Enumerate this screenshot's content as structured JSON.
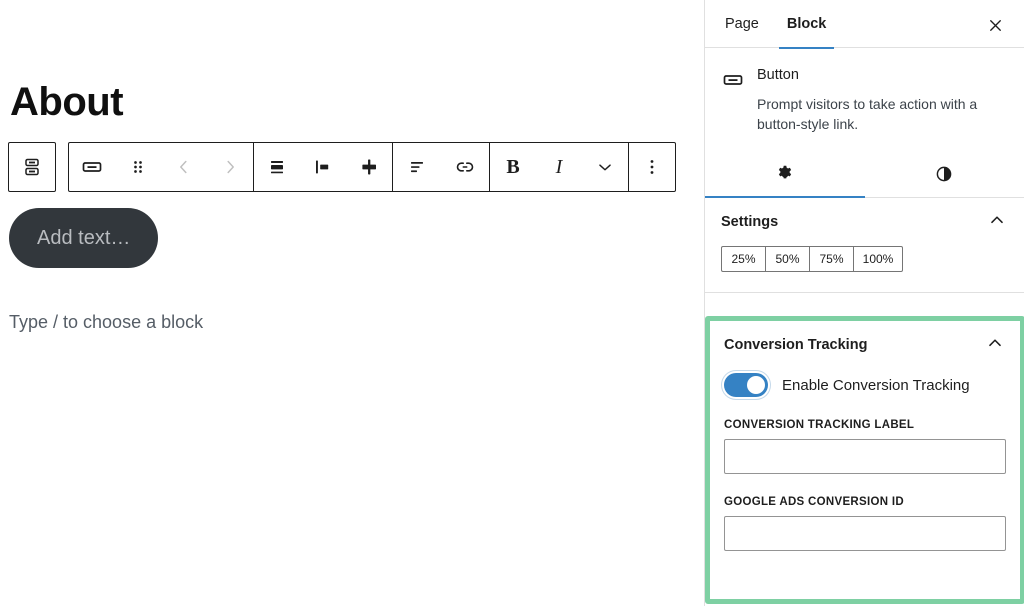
{
  "editor": {
    "page_title": "About",
    "button_block": {
      "placeholder_text": "Add text…"
    },
    "empty_paragraph_placeholder": "Type / to choose a block",
    "toolbar": {
      "parent_selector_label": "Select Buttons",
      "items": [
        {
          "name": "block-type-button",
          "label": "Button"
        },
        {
          "name": "drag-handle",
          "label": "Drag"
        },
        {
          "name": "move-up",
          "label": "Move up"
        },
        {
          "name": "move-down",
          "label": "Move down"
        },
        {
          "name": "change-width",
          "label": "Change width"
        },
        {
          "name": "align-left",
          "label": "Align left"
        },
        {
          "name": "stretch-to-fill",
          "label": "Stretch to fill"
        },
        {
          "name": "text-align",
          "label": "Align text"
        },
        {
          "name": "link",
          "label": "Link"
        },
        {
          "name": "bold",
          "label": "B"
        },
        {
          "name": "italic",
          "label": "I"
        },
        {
          "name": "more-formatting",
          "label": "More"
        },
        {
          "name": "block-options",
          "label": "Options"
        }
      ]
    }
  },
  "sidebar": {
    "tabs": [
      {
        "label": "Page",
        "active": false
      },
      {
        "label": "Block",
        "active": true
      }
    ],
    "close_label": "Close Settings",
    "block_card": {
      "icon": "button-icon",
      "title": "Button",
      "description": "Prompt visitors to take action with a button-style link."
    },
    "icon_tabs": [
      {
        "name": "settings-tab",
        "icon": "gear-icon",
        "active": true
      },
      {
        "name": "styles-tab",
        "icon": "contrast-icon",
        "active": false
      }
    ],
    "settings_panel": {
      "title": "Settings",
      "collapse_icon": "chevron-up-icon",
      "width_options": [
        "25%",
        "50%",
        "75%",
        "100%"
      ]
    },
    "conversion_panel": {
      "title": "Conversion Tracking",
      "collapse_icon": "chevron-up-icon",
      "toggle": {
        "label": "Enable Conversion Tracking",
        "enabled": true
      },
      "fields": [
        {
          "label": "Conversion Tracking Label",
          "value": "",
          "placeholder": ""
        },
        {
          "label": "Google Ads Conversion ID",
          "value": "",
          "placeholder": ""
        }
      ],
      "highlight_color": "#7ed0a3"
    }
  }
}
